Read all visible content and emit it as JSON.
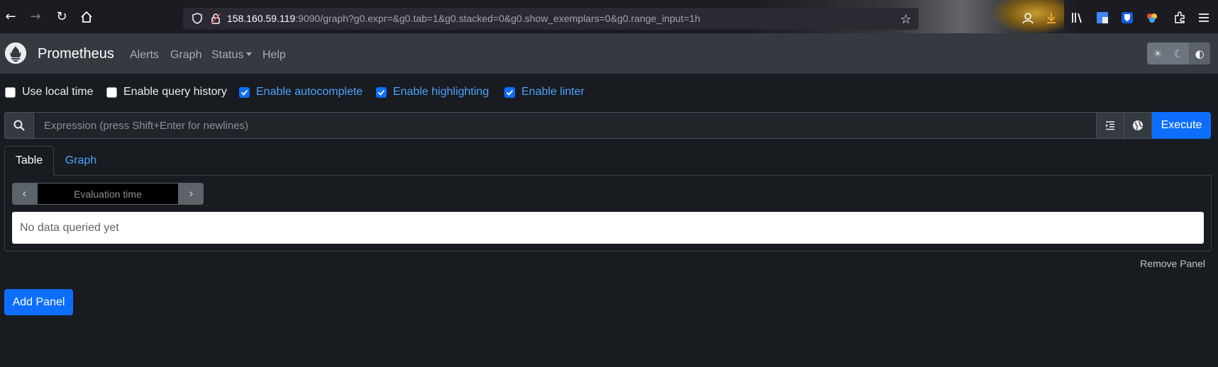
{
  "browser": {
    "url_host": "158.160.59.119",
    "url_rest": ":9090/graph?g0.expr=&g0.tab=1&g0.stacked=0&g0.show_exemplars=0&g0.range_input=1h"
  },
  "navbar": {
    "brand": "Prometheus",
    "links": [
      "Alerts",
      "Graph",
      "Status",
      "Help"
    ]
  },
  "options": [
    {
      "label": "Use local time",
      "checked": false
    },
    {
      "label": "Enable query history",
      "checked": false
    },
    {
      "label": "Enable autocomplete",
      "checked": true
    },
    {
      "label": "Enable highlighting",
      "checked": true
    },
    {
      "label": "Enable linter",
      "checked": true
    }
  ],
  "expression": {
    "placeholder": "Expression (press Shift+Enter for newlines)",
    "value": "",
    "execute_label": "Execute"
  },
  "panel": {
    "tabs": [
      "Table",
      "Graph"
    ],
    "active_tab": "Table",
    "eval_time_placeholder": "Evaluation time",
    "no_data_text": "No data queried yet",
    "remove_label": "Remove Panel"
  },
  "add_panel_label": "Add Panel",
  "colors": {
    "accent": "#0d6efd",
    "link": "#4ca3ff",
    "navbar": "#343a40",
    "background": "#181b1f"
  }
}
